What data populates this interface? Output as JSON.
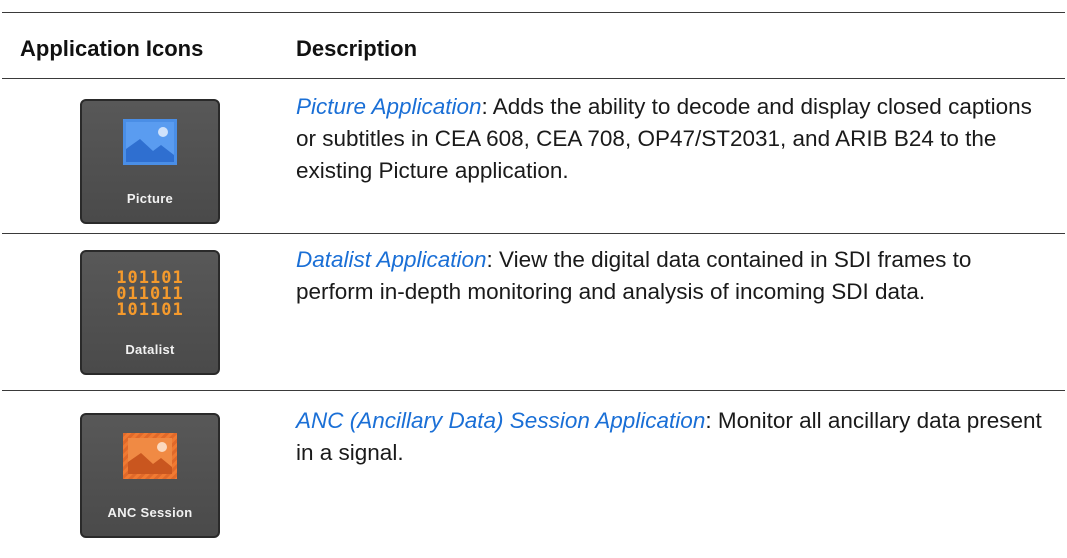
{
  "header": {
    "icons_label": "Application Icons",
    "description_label": "Description"
  },
  "rows": [
    {
      "icon_name": "picture-icon",
      "icon_label": "Picture",
      "icon_color": "#4a8ee6",
      "link_text": "Picture Application",
      "description": ": Adds the ability to decode and display closed captions or subtitles in CEA 608, CEA 708, OP47/ST2031, and ARIB B24 to the existing Picture application."
    },
    {
      "icon_name": "datalist-icon",
      "icon_label": "Datalist",
      "icon_color": "#f59a2c",
      "binary_lines": [
        "101101",
        "011011",
        "101101"
      ],
      "link_text": "Datalist Application",
      "description": ": View the digital data contained in SDI frames to perform in-depth monitoring and analysis of incoming SDI data."
    },
    {
      "icon_name": "anc-session-icon",
      "icon_label": "ANC Session",
      "icon_color": "#f07a32",
      "link_text": "ANC (Ancillary Data) Session Application",
      "description": ": Monitor all ancillary data present in a signal."
    }
  ]
}
